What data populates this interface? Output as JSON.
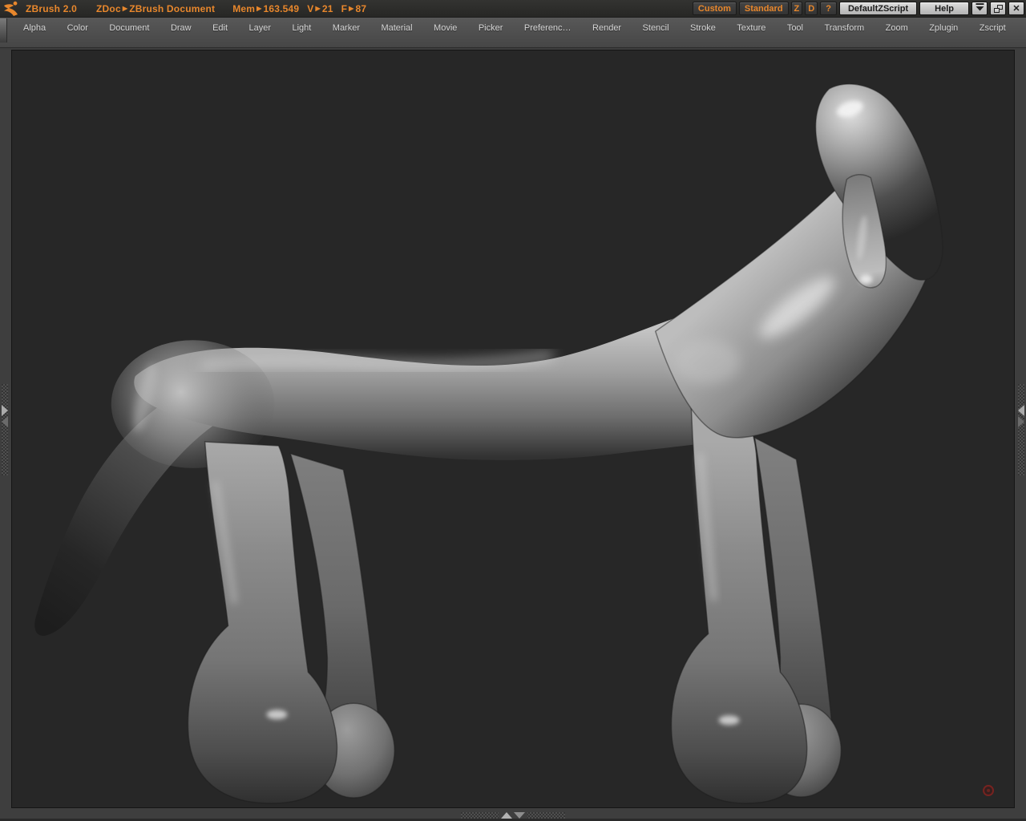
{
  "titlebar": {
    "title": "ZBrush 2.0",
    "sep": "▶",
    "doc": {
      "label": "ZDoc",
      "name": "ZBrush Document"
    },
    "stats": {
      "mem_label": "Mem",
      "mem": "163.549",
      "views_label": "V",
      "views": "21",
      "frames_label": "F",
      "frames": "87"
    },
    "buttons": {
      "custom": "Custom",
      "standard": "Standard",
      "z": "Z",
      "d": "D",
      "question": "?",
      "default_zscript": "DefaultZScript",
      "help": "Help",
      "close": "✕"
    }
  },
  "menubar": {
    "items": [
      "Alpha",
      "Color",
      "Document",
      "Draw",
      "Edit",
      "Layer",
      "Light",
      "Marker",
      "Material",
      "Movie",
      "Picker",
      "Preferenc…",
      "Render",
      "Stencil",
      "Stroke",
      "Texture",
      "Tool",
      "Transform",
      "Zoom",
      "Zplugin",
      "Zscript"
    ]
  },
  "canvas": {
    "description": "Stylized gray quadruped creature sculpt (horse/dog-like) with long tail, arched neck and raised head, default gray material on dark ZBrush document canvas"
  },
  "colors": {
    "accent_orange": "#e8872c",
    "titlebar_bg": "#2b2b2b",
    "menubar_bg": "#4f4f4f",
    "frame_bg": "#3e3e3e",
    "canvas_bg": "#272727",
    "light_button": "#c9c9c9",
    "marker_red": "#772320"
  }
}
